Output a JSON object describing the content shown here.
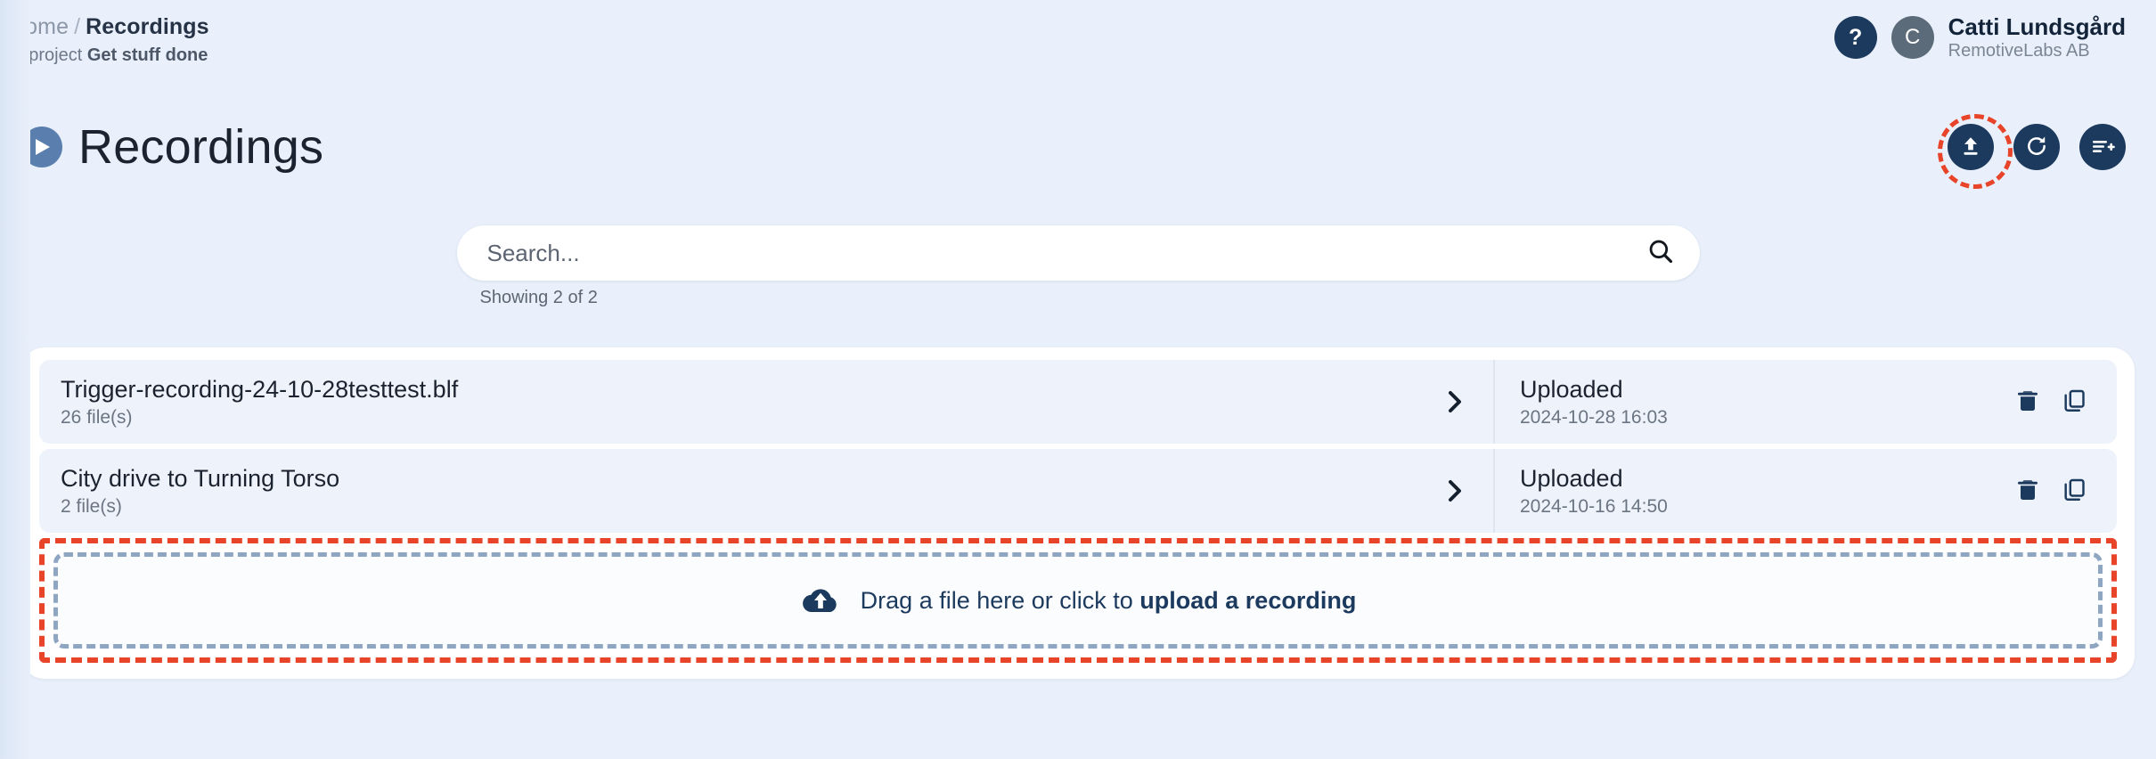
{
  "breadcrumb": {
    "home": "Home",
    "separator": "/",
    "current": "Recordings",
    "project_prefix": "In project",
    "project_name": "Get stuff done"
  },
  "user": {
    "help_label": "?",
    "avatar_initial": "C",
    "name": "Catti Lundsgård",
    "organization": "RemotiveLabs AB"
  },
  "page": {
    "title": "Recordings",
    "play_icon": "play-icon"
  },
  "header_actions": [
    {
      "name": "upload-recording-button",
      "icon": "upload-icon",
      "highlighted": true
    },
    {
      "name": "refresh-button",
      "icon": "refresh-icon",
      "highlighted": false
    },
    {
      "name": "new-playlist-button",
      "icon": "list-add-icon",
      "highlighted": false
    }
  ],
  "search": {
    "placeholder": "Search...",
    "value": "",
    "icon": "search-icon",
    "showing": "Showing 2 of 2"
  },
  "recordings": [
    {
      "title": "Trigger-recording-24-10-28testtest.blf",
      "files": "26 file(s)",
      "status": "Uploaded",
      "date": "2024-10-28 16:03"
    },
    {
      "title": "City drive to Turning Torso",
      "files": "2 file(s)",
      "status": "Uploaded",
      "date": "2024-10-16 14:50"
    }
  ],
  "row_actions": {
    "delete": "delete-icon",
    "copy": "copy-icon",
    "expand": "chevron-right-icon"
  },
  "dropzone": {
    "text_plain": "Drag a file here or click to ",
    "text_bold": "upload a recording",
    "icon": "cloud-upload-icon"
  },
  "colors": {
    "background": "#e9f0fb",
    "navy": "#1c3a5e",
    "accent_red": "#e8442a",
    "row_bg": "#eef2fa",
    "muted_text": "#6b7583"
  }
}
